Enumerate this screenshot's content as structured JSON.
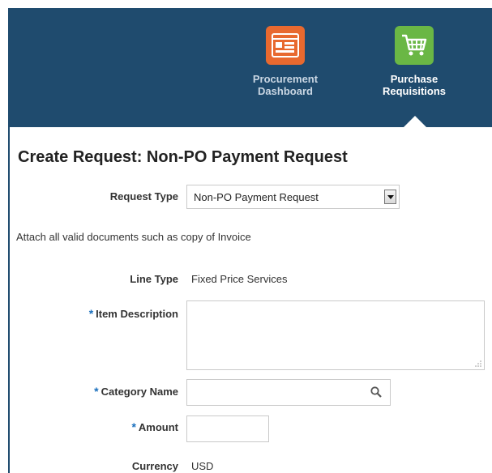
{
  "nav": {
    "items": [
      {
        "id": "procurement",
        "line1": "Procurement",
        "line2": "Dashboard",
        "icon": "dashboard-icon",
        "color": "#e8692f"
      },
      {
        "id": "purchase",
        "line1": "Purchase",
        "line2": "Requisitions",
        "icon": "shopping-cart-icon",
        "color": "#6ab745",
        "selected": true
      }
    ]
  },
  "header_color": "#1f4b6e",
  "page": {
    "title": "Create Request: Non-PO Payment Request"
  },
  "form": {
    "request_type": {
      "label": "Request Type",
      "value": "Non-PO Payment Request"
    },
    "attach_note": "Attach all valid documents such as copy of Invoice",
    "line_type": {
      "label": "Line Type",
      "value": "Fixed Price Services"
    },
    "item_description": {
      "label": "Item Description",
      "required": "*",
      "value": ""
    },
    "category_name": {
      "label": "Category Name",
      "required": "*",
      "value": ""
    },
    "amount": {
      "label": "Amount",
      "required": "*",
      "value": ""
    },
    "currency": {
      "label": "Currency",
      "value": "USD"
    }
  }
}
